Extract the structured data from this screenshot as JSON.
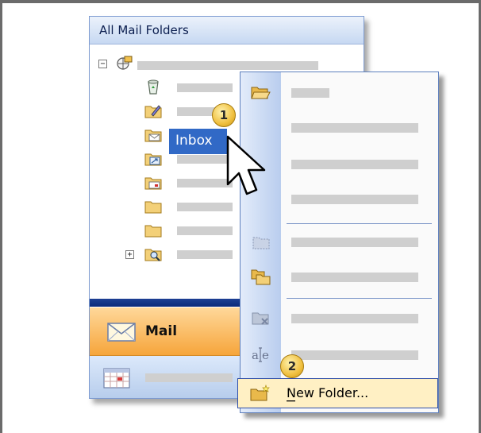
{
  "folder_pane": {
    "header": "All Mail Folders",
    "selected_folder": "Inbox"
  },
  "navigation": {
    "mail_label": "Mail"
  },
  "context_menu": {
    "new_folder_label": "New Folder..."
  },
  "callouts": {
    "step1": "1",
    "step2": "2"
  },
  "icons": {
    "root": "mailbox-root-icon",
    "deleted": "deleted-items-icon",
    "drafts": "drafts-icon",
    "inbox": "inbox-icon",
    "outbox": "outbox-icon",
    "sent": "sent-items-icon",
    "search": "search-folder-icon",
    "calendar": "calendar-icon",
    "new_folder": "new-folder-icon"
  },
  "colors": {
    "selection": "#3169c6",
    "mail_button": "#f6a53b",
    "menu_highlight": "#fff0c4",
    "callout_badge": "#f0c040"
  }
}
